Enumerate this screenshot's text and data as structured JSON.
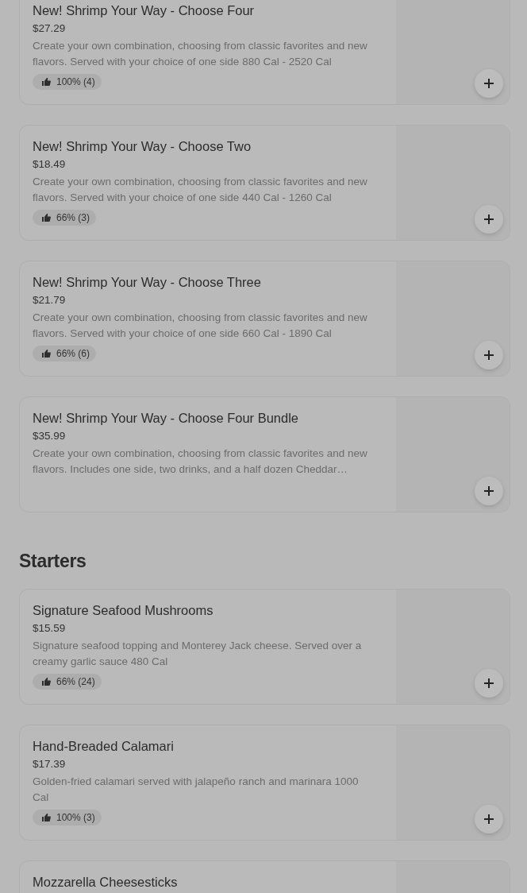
{
  "sections": [
    {
      "items": [
        {
          "name": "New! Shrimp Your Way - Choose Four",
          "price": "$27.29",
          "description": "Create your own combination, choosing from classic favorites and new flavors. Served with your choice of one side 880 Cal - 2520 Cal",
          "rating": "100% (4)"
        },
        {
          "name": "New! Shrimp Your Way - Choose Two",
          "price": "$18.49",
          "description": "Create your own combination, choosing from classic favorites and new flavors. Served with your choice of one side 440 Cal - 1260 Cal",
          "rating": "66% (3)"
        },
        {
          "name": "New! Shrimp Your Way - Choose Three",
          "price": "$21.79",
          "description": "Create your own combination, choosing from classic favorites and new flavors. Served with your choice of one side 660 Cal - 1890 Cal",
          "rating": "66% (6)"
        },
        {
          "name": "New! Shrimp Your Way - Choose Four Bundle",
          "price": "$35.99",
          "description": "Create your own combination, choosing from classic favorites and new flavors. Includes one side, two drinks, and a half dozen Cheddar…"
        }
      ]
    },
    {
      "heading": "Starters",
      "items": [
        {
          "name": "Signature Seafood Mushrooms",
          "price": "$15.59",
          "description": "Signature seafood topping and Monterey Jack cheese. Served over a creamy garlic sauce 480 Cal",
          "rating": "66% (24)"
        },
        {
          "name": "Hand-Breaded Calamari",
          "price": "$17.39",
          "description": "Golden-fried calamari served with jalapeño ranch and marinara 1000 Cal",
          "rating": "100% (3)"
        },
        {
          "name": "Mozzarella Cheesesticks"
        }
      ]
    }
  ]
}
